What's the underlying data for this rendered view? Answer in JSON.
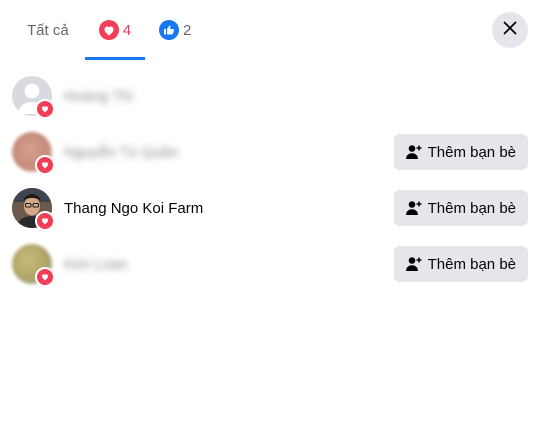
{
  "tabs": {
    "all_label": "Tất cả",
    "love_count": "4",
    "like_count": "2"
  },
  "people": [
    {
      "name": "Hoàng Thi",
      "blurred": true,
      "avatar": "default-avatar",
      "has_button": false
    },
    {
      "name": "Nguyễn Tú Quân",
      "blurred": true,
      "avatar": "blurred-photo",
      "has_button": true
    },
    {
      "name": "Thang Ngo Koi Farm",
      "blurred": false,
      "avatar": "profile-photo",
      "has_button": true
    },
    {
      "name": "Kim Loan",
      "blurred": true,
      "avatar": "blurred-photo",
      "has_button": true
    }
  ],
  "add_friend_label": "Thêm bạn bè",
  "icons": {
    "love": "heart-reaction-icon",
    "like": "thumbs-up-reaction-icon",
    "close": "close-icon",
    "add_friend": "add-friend-icon"
  },
  "colors": {
    "love": "#f33e58",
    "like": "#1877f2",
    "button_bg": "#e4e6eb"
  }
}
